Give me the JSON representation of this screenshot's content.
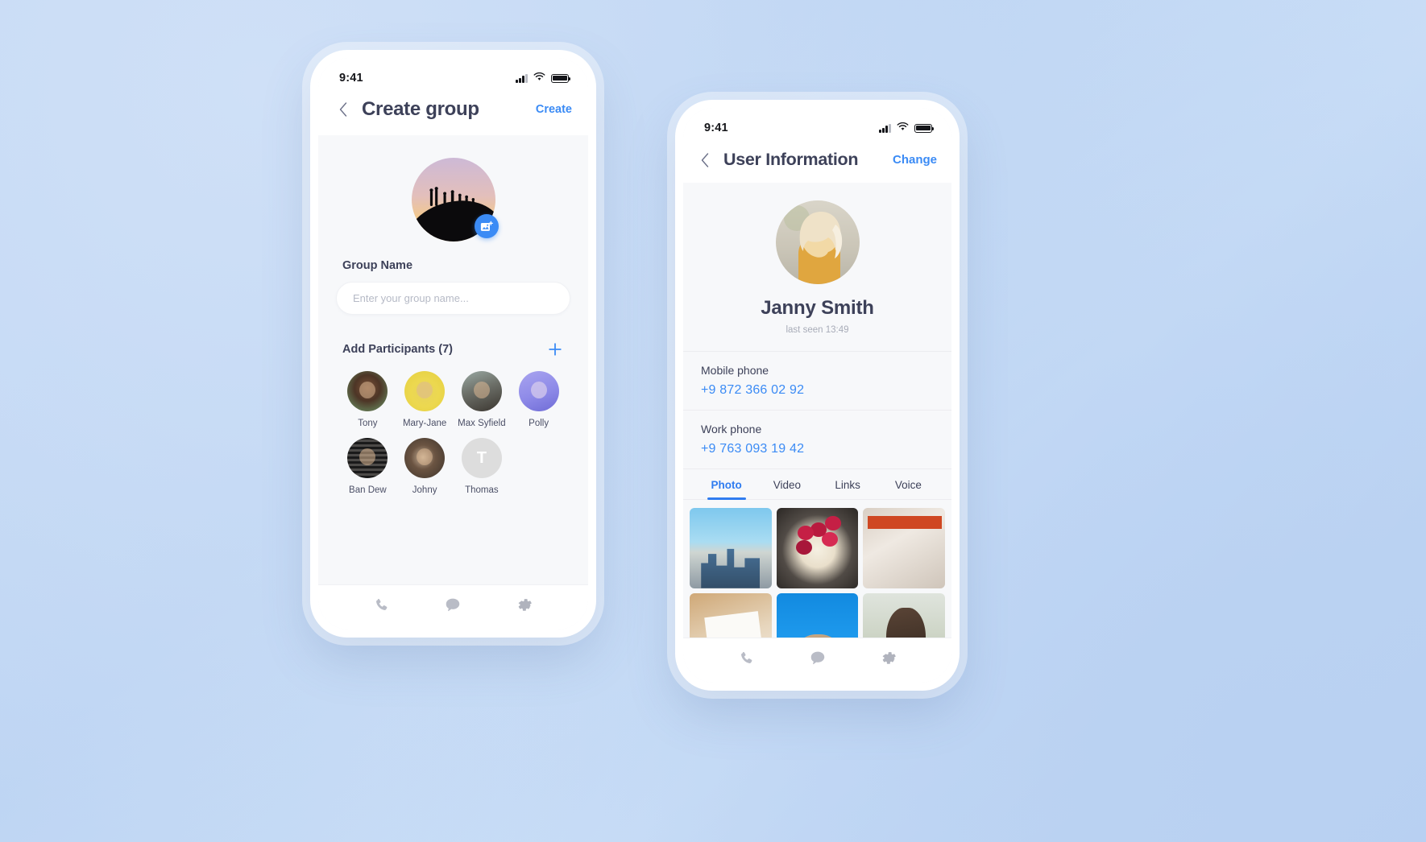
{
  "left_phone": {
    "status": {
      "time": "9:41",
      "signal_icon": "signal-bars-icon",
      "wifi_icon": "wifi-icon",
      "battery_icon": "battery-full-icon"
    },
    "nav": {
      "back_icon": "chevron-left-icon",
      "title": "Create group",
      "action_label": "Create"
    },
    "group_avatar": {
      "icon": "group-photo-avatar",
      "camera_badge_icon": "add-photo-icon"
    },
    "group_name": {
      "label": "Group Name",
      "value": "",
      "placeholder": "Enter your group name..."
    },
    "participants": {
      "title": "Add Participants (7)",
      "add_icon": "plus-icon",
      "people": [
        {
          "name": "Tony",
          "avatar": "avatar-tony"
        },
        {
          "name": "Mary-Jane",
          "avatar": "avatar-mary-jane"
        },
        {
          "name": "Max Syfield",
          "avatar": "avatar-max-syfield"
        },
        {
          "name": "Polly",
          "avatar": "avatar-polly"
        },
        {
          "name": "Ban Dew",
          "avatar": "avatar-ban-dew"
        },
        {
          "name": "Johny",
          "avatar": "avatar-johny"
        },
        {
          "name": "Thomas",
          "avatar": "avatar-initial",
          "initial": "T"
        }
      ]
    },
    "tabbar": [
      {
        "icon": "phone-icon"
      },
      {
        "icon": "chat-bubble-icon"
      },
      {
        "icon": "gear-icon"
      }
    ]
  },
  "right_phone": {
    "status": {
      "time": "9:41",
      "signal_icon": "signal-bars-icon",
      "wifi_icon": "wifi-icon",
      "battery_icon": "battery-full-icon"
    },
    "nav": {
      "back_icon": "chevron-left-icon",
      "title": "User Information",
      "action_label": "Change"
    },
    "profile": {
      "avatar": "avatar-janny-smith",
      "name": "Janny Smith",
      "last_seen": "last seen 13:49"
    },
    "info": [
      {
        "label": "Mobile phone",
        "value": "+9 872 366 02 92"
      },
      {
        "label": "Work phone",
        "value": "+9 763 093 19 42"
      }
    ],
    "media_tabs": [
      {
        "label": "Photo",
        "active": true
      },
      {
        "label": "Video",
        "active": false
      },
      {
        "label": "Links",
        "active": false
      },
      {
        "label": "Voice",
        "active": false
      }
    ],
    "media_grid": [
      {
        "name": "photo-city-skyline"
      },
      {
        "name": "photo-raspberry-cake"
      },
      {
        "name": "photo-book-stack"
      },
      {
        "name": "photo-desk-paper"
      },
      {
        "name": "photo-cat-blue-sky"
      },
      {
        "name": "photo-woman-portrait"
      }
    ],
    "tabbar": [
      {
        "icon": "phone-icon"
      },
      {
        "icon": "chat-bubble-icon"
      },
      {
        "icon": "gear-icon"
      }
    ]
  },
  "colors": {
    "accent": "#3b8bf5",
    "tab_active": "#2f7cf0",
    "heading": "#3d4159",
    "muted": "#a8acb8",
    "screen_bg": "#f7f8fa",
    "background": "#c3d8f4"
  }
}
